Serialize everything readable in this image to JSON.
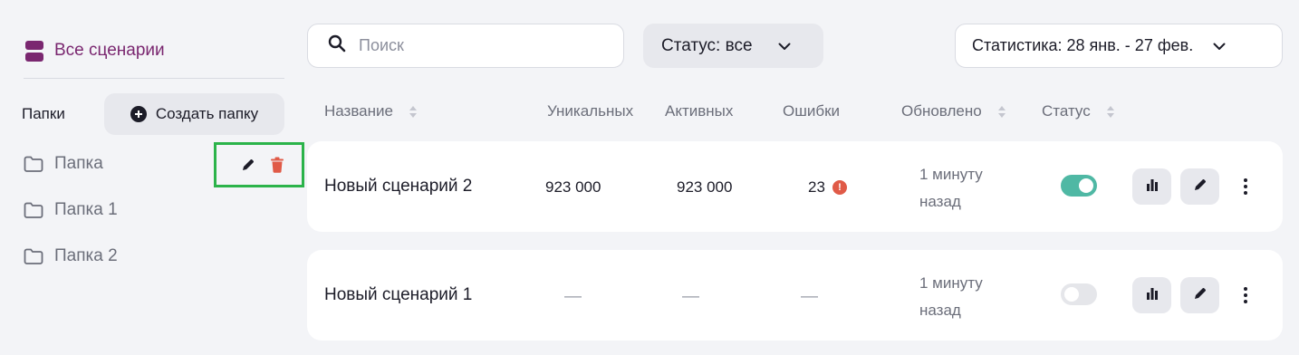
{
  "sidebar": {
    "all_scenarios_label": "Все сценарии",
    "folders_label": "Папки",
    "create_folder_label": "Создать папку",
    "folders": [
      {
        "label": "Папка",
        "hovered": true
      },
      {
        "label": "Папка 1"
      },
      {
        "label": "Папка 2"
      }
    ]
  },
  "toolbar": {
    "search_placeholder": "Поиск",
    "search_value": "",
    "status_filter_label": "Статус: все",
    "stats_filter_label": "Статистика: 28 янв. - 27 фев."
  },
  "table": {
    "headers": {
      "name": "Название",
      "unique": "Уникальных",
      "active": "Активных",
      "errors": "Ошибки",
      "updated": "Обновлено",
      "status": "Статус"
    },
    "rows": [
      {
        "name": "Новый сценарий 2",
        "unique": "923 000",
        "active": "923 000",
        "errors": "23",
        "error_badge": "!",
        "updated": "1 минуту назад",
        "status_on": true
      },
      {
        "name": "Новый сценарий 1",
        "unique": "—",
        "active": "—",
        "errors": "—",
        "updated": "1 минуту назад",
        "status_on": false
      }
    ]
  },
  "colors": {
    "accent": "#7a2770",
    "toggle_on": "#4fb8a4",
    "error": "#e05a47",
    "highlight_border": "#2bb34a"
  }
}
